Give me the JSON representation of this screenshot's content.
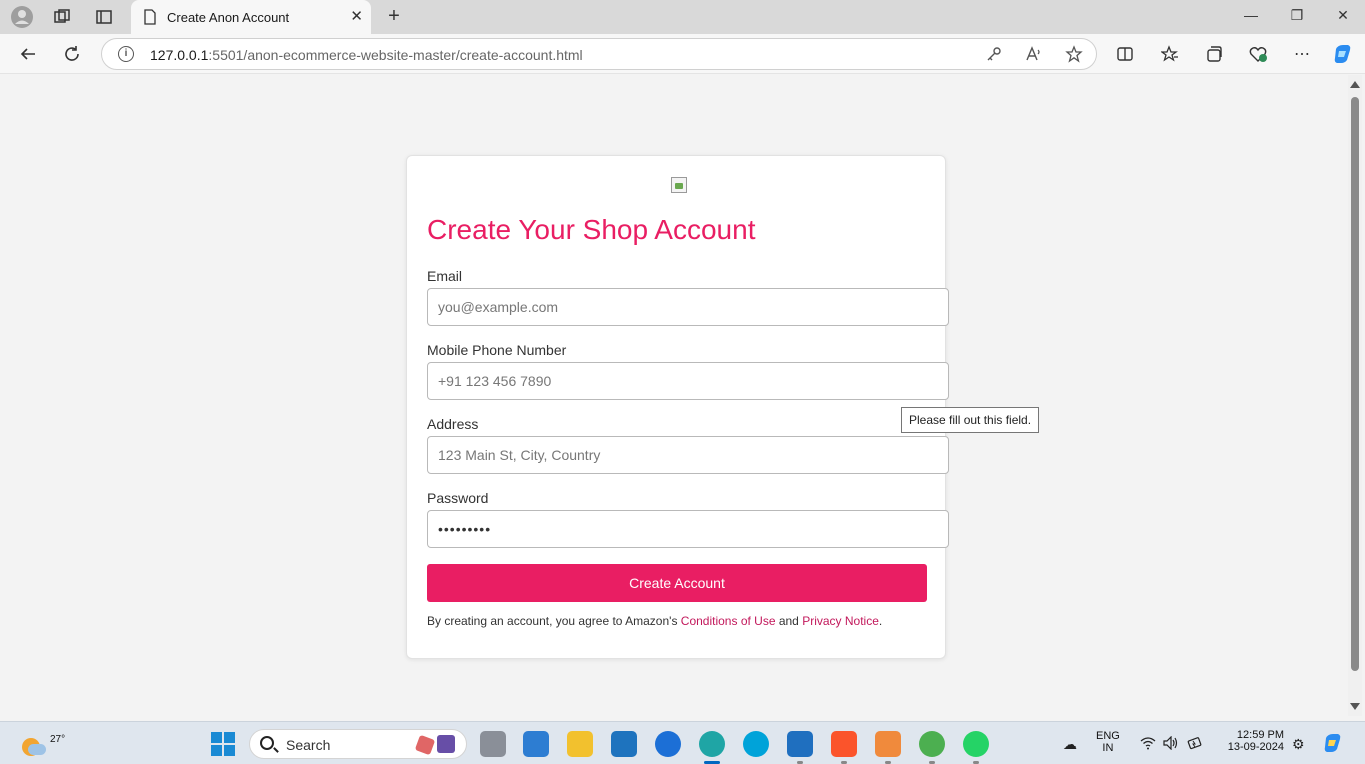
{
  "browser": {
    "tab_title": "Create Anon Account",
    "url_host": "127.0.0.1",
    "url_rest": ":5501/anon-ecommerce-website-master/create-account.html",
    "new_tab_symbol": "+",
    "close_tab_symbol": "✕"
  },
  "page": {
    "heading": "Create Your Shop Account",
    "email_label": "Email",
    "email_placeholder": "you@example.com",
    "phone_label": "Mobile Phone Number",
    "phone_placeholder": "+91 123 456 7890",
    "address_label": "Address",
    "address_placeholder": "123 Main St, City, Country",
    "password_label": "Password",
    "password_value": "•••••••••",
    "submit_label": "Create Account",
    "terms_prefix": "By creating an account, you agree to Amazon's ",
    "terms_link1": "Conditions of Use",
    "terms_mid": " and ",
    "terms_link2": "Privacy Notice",
    "terms_suffix": ".",
    "tooltip": "Please fill out this field.",
    "accent_color": "#e91e63"
  },
  "taskbar": {
    "weather_temp": "27°",
    "search_placeholder": "Search",
    "lang_line1": "ENG",
    "lang_line2": "IN",
    "time": "12:59 PM",
    "date": "13-09-2024"
  }
}
